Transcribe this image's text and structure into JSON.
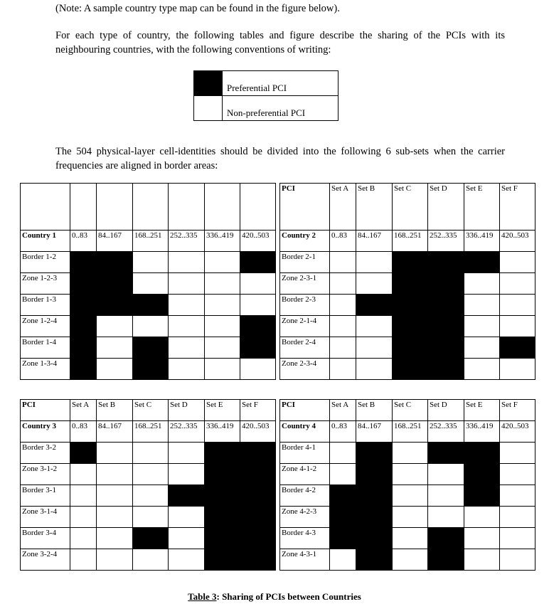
{
  "paragraphs": {
    "note": "(Note: A sample country type map can be found in the figure below).",
    "intro": "For each type of country, the following tables and figure describe the sharing of the PCIs with its neighbouring countries, with the following conventions of writing:",
    "subsets": "The 504 physical-layer cell-identities should be divided into the following 6 sub-sets when the carrier frequencies are aligned in border areas:"
  },
  "legend": {
    "preferential": "Preferential PCI",
    "non_preferential": "Non-preferential PCI"
  },
  "ranges": [
    "0..83",
    "84..167",
    "168..251",
    "252..335",
    "336..419",
    "420..503"
  ],
  "tables": [
    {
      "pci_label": "",
      "sets": [
        "",
        "",
        "",
        "",
        "",
        ""
      ],
      "country": "Country 1",
      "rows": [
        {
          "label": "Border 1-2",
          "cells": [
            1,
            1,
            0,
            0,
            0,
            1
          ]
        },
        {
          "label": "Zone 1-2-3",
          "cells": [
            1,
            1,
            0,
            0,
            0,
            0
          ]
        },
        {
          "label": "Border 1-3",
          "cells": [
            1,
            1,
            1,
            0,
            0,
            0
          ]
        },
        {
          "label": "Zone 1-2-4",
          "cells": [
            1,
            0,
            0,
            0,
            0,
            1
          ]
        },
        {
          "label": "Border 1-4",
          "cells": [
            1,
            0,
            1,
            0,
            0,
            1
          ]
        },
        {
          "label": "Zone 1-3-4",
          "cells": [
            1,
            0,
            1,
            0,
            0,
            0
          ]
        }
      ]
    },
    {
      "pci_label": "PCI",
      "sets": [
        "Set A",
        "Set B",
        "Set C",
        "Set D",
        "Set E",
        "Set F"
      ],
      "country": "Country 2",
      "rows": [
        {
          "label": "Border 2-1",
          "cells": [
            0,
            0,
            1,
            1,
            1,
            0
          ]
        },
        {
          "label": "Zone 2-3-1",
          "cells": [
            0,
            0,
            1,
            1,
            0,
            0
          ]
        },
        {
          "label": "Border 2-3",
          "cells": [
            0,
            1,
            1,
            1,
            0,
            0
          ]
        },
        {
          "label": "Zone 2-1-4",
          "cells": [
            0,
            0,
            1,
            1,
            0,
            0
          ]
        },
        {
          "label": "Border 2-4",
          "cells": [
            0,
            0,
            1,
            1,
            0,
            1
          ]
        },
        {
          "label": "Zone 2-3-4",
          "cells": [
            0,
            0,
            1,
            1,
            0,
            0
          ]
        }
      ]
    },
    {
      "pci_label": "PCI",
      "sets": [
        "Set A",
        "Set B",
        "Set C",
        "Set D",
        "Set E",
        "Set F"
      ],
      "country": "Country 3",
      "rows": [
        {
          "label": "Border 3-2",
          "cells": [
            1,
            0,
            0,
            0,
            1,
            1
          ]
        },
        {
          "label": "Zone 3-1-2",
          "cells": [
            0,
            0,
            0,
            0,
            1,
            1
          ]
        },
        {
          "label": "Border 3-1",
          "cells": [
            0,
            0,
            0,
            1,
            1,
            1
          ]
        },
        {
          "label": "Zone 3-1-4",
          "cells": [
            0,
            0,
            0,
            0,
            1,
            1
          ]
        },
        {
          "label": "Border 3-4",
          "cells": [
            0,
            0,
            1,
            0,
            1,
            1
          ]
        },
        {
          "label": "Zone 3-2-4",
          "cells": [
            0,
            0,
            0,
            0,
            1,
            1
          ]
        }
      ]
    },
    {
      "pci_label": "PCI",
      "sets": [
        "Set A",
        "Set B",
        "Set C",
        "Set D",
        "Set E",
        "Set F"
      ],
      "country": "Country 4",
      "rows": [
        {
          "label": "Border 4-1",
          "cells": [
            0,
            1,
            0,
            1,
            1,
            0
          ]
        },
        {
          "label": "Zone 4-1-2",
          "cells": [
            0,
            1,
            0,
            0,
            1,
            0
          ]
        },
        {
          "label": "Border 4-2",
          "cells": [
            1,
            1,
            0,
            0,
            1,
            0
          ]
        },
        {
          "label": "Zone 4-2-3",
          "cells": [
            1,
            1,
            0,
            0,
            0,
            0
          ]
        },
        {
          "label": "Border 4-3",
          "cells": [
            1,
            1,
            0,
            1,
            0,
            0
          ]
        },
        {
          "label": "Zone 4-3-1",
          "cells": [
            0,
            1,
            0,
            1,
            0,
            0
          ]
        }
      ]
    }
  ],
  "caption": {
    "label": "Table 3",
    "text": ": Sharing of PCIs between Countries"
  },
  "colors": {
    "preferential": "#000000",
    "non_preferential": "#ffffff"
  }
}
